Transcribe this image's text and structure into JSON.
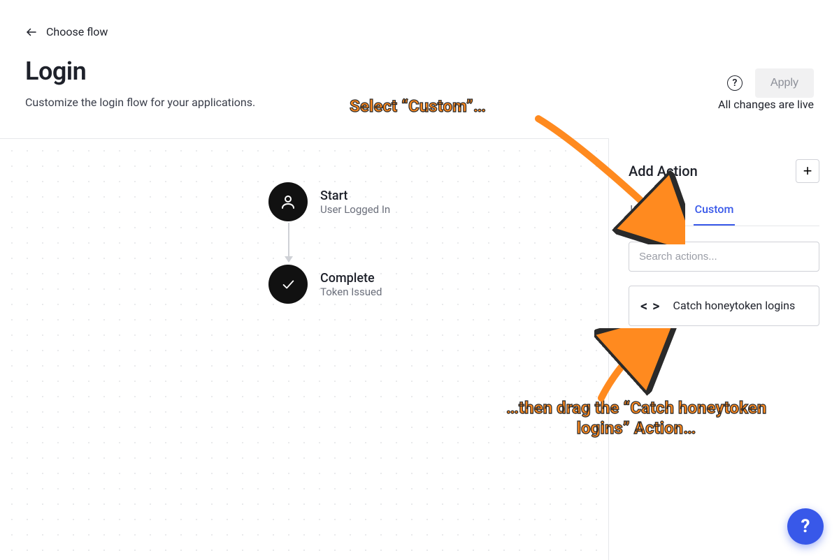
{
  "breadcrumb": {
    "label": "Choose flow"
  },
  "page": {
    "title": "Login",
    "subtitle": "Customize the login flow for your applications."
  },
  "header": {
    "apply_label": "Apply",
    "status": "All changes are live"
  },
  "flow": {
    "start": {
      "title": "Start",
      "sub": "User Logged In"
    },
    "complete": {
      "title": "Complete",
      "sub": "Token Issued"
    }
  },
  "panel": {
    "title": "Add Action",
    "tabs": {
      "installed": "Installed",
      "custom": "Custom",
      "active": "custom"
    },
    "search_placeholder": "Search actions...",
    "actions": [
      {
        "title": "Catch honeytoken logins"
      }
    ]
  },
  "annotations": {
    "a1": "Select “Custom”…",
    "a2": "…then drag the “Catch honeytoken logins” Action…"
  },
  "fab": {
    "glyph": "?"
  },
  "help_icon_glyph": "?",
  "add_icon_glyph": "+",
  "code_icon_glyph": "< >"
}
